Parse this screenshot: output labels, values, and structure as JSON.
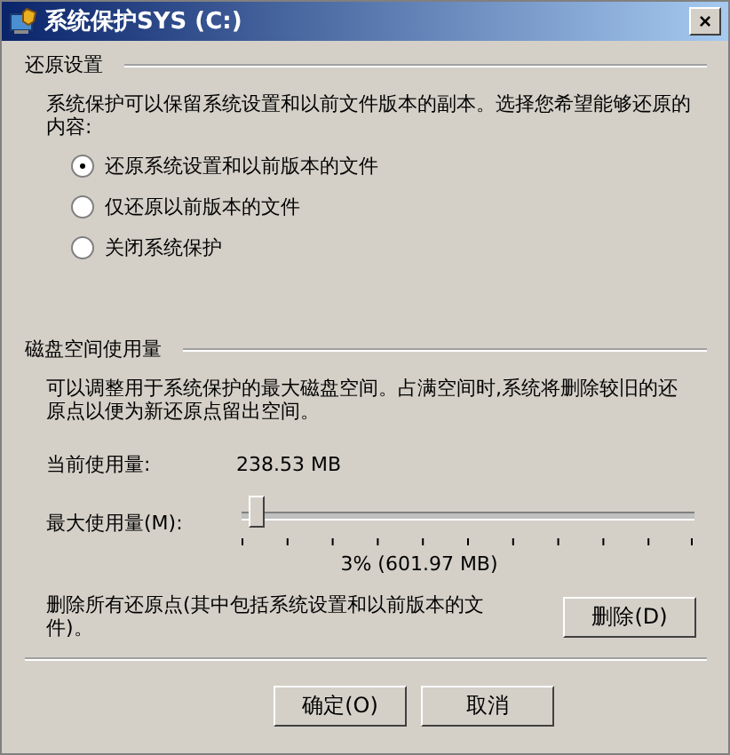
{
  "window": {
    "title": "系统保护SYS (C:)",
    "close": "×"
  },
  "restore_settings": {
    "heading": "还原设置",
    "description": "系统保护可以保留系统设置和以前文件版本的副本。选择您希望能够还原的内容:",
    "options": [
      {
        "label": "还原系统设置和以前版本的文件",
        "selected": true
      },
      {
        "label": "仅还原以前版本的文件",
        "selected": false
      },
      {
        "label": "关闭系统保护",
        "selected": false
      }
    ]
  },
  "disk_usage": {
    "heading": "磁盘空间使用量",
    "description": "可以调整用于系统保护的最大磁盘空间。占满空间时,系统将删除较旧的还原点以便为新还原点留出空间。",
    "current_label": "当前使用量:",
    "current_value": "238.53 MB",
    "max_label": "最大使用量(M):",
    "slider": {
      "level": 0.03
    },
    "max_reading": "3% (601.97 MB)",
    "delete_text": "删除所有还原点(其中包括系统设置和以前版本的文件)。",
    "delete_button": "删除(D)"
  },
  "buttons": [
    "确定(O)",
    "取消"
  ]
}
